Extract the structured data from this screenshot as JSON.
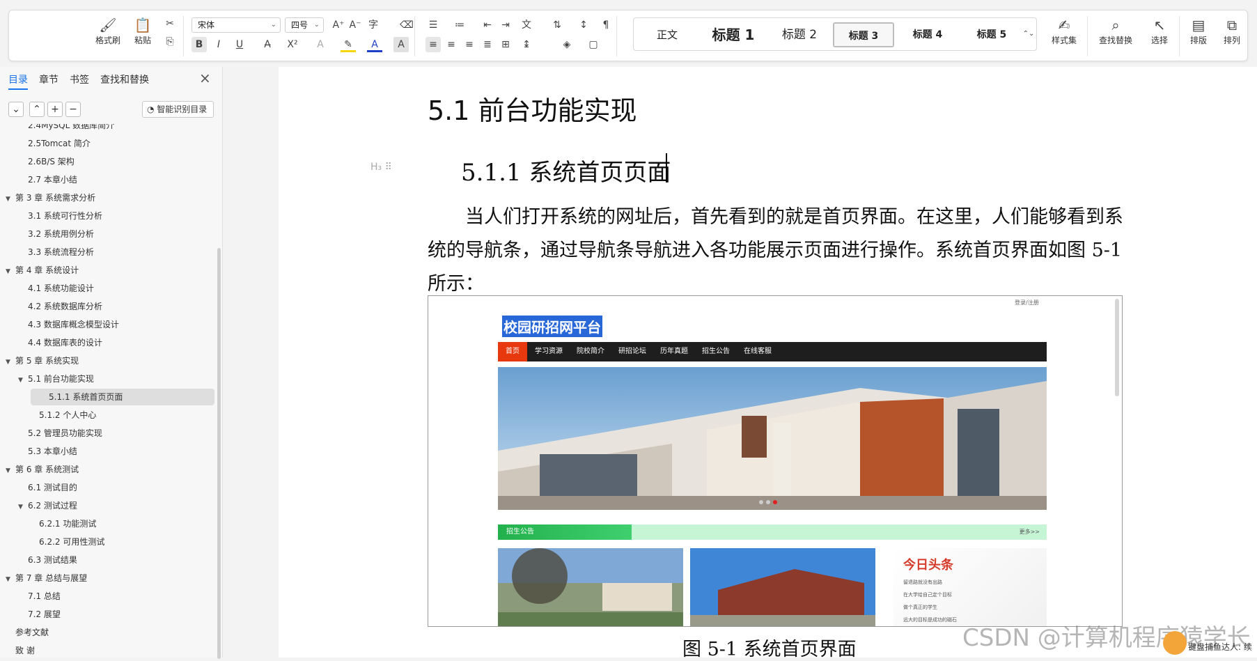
{
  "ribbon": {
    "format_painter": "格式刷",
    "paste": "粘贴",
    "font_name": "宋体",
    "font_size": "四号",
    "styles": [
      "正文",
      "标题 1",
      "标题 2",
      "标题 3",
      "标题 4",
      "标题 5"
    ],
    "style_set": "样式集",
    "find_replace": "查找替换",
    "select": "选择",
    "layout": "排版",
    "arrange": "排列"
  },
  "sidebar": {
    "tabs": [
      "目录",
      "章节",
      "书签",
      "查找和替换"
    ],
    "smart_toc": "智能识别目录",
    "toc": [
      {
        "label": "2.4MySQL 数据库简介",
        "level": 2
      },
      {
        "label": "2.5Tomcat 简介",
        "level": 2
      },
      {
        "label": "2.6B/S 架构",
        "level": 2
      },
      {
        "label": "2.7 本章小结",
        "level": 2
      },
      {
        "label": "第 3 章  系统需求分析",
        "level": 1
      },
      {
        "label": "3.1 系统可行性分析",
        "level": 2
      },
      {
        "label": "3.2 系统用例分析",
        "level": 2
      },
      {
        "label": "3.3 系统流程分析",
        "level": 2
      },
      {
        "label": "第 4 章  系统设计",
        "level": 1
      },
      {
        "label": "4.1 系统功能设计",
        "level": 2
      },
      {
        "label": "4.2 系统数据库分析",
        "level": 2
      },
      {
        "label": "4.3 数据库概念模型设计",
        "level": 2
      },
      {
        "label": "4.4 数据库表的设计",
        "level": 2
      },
      {
        "label": "第 5 章  系统实现",
        "level": 1
      },
      {
        "label": "5.1 前台功能实现",
        "level": 2
      },
      {
        "label": "5.1.1 系统首页页面",
        "level": 3
      },
      {
        "label": "5.1.2 个人中心",
        "level": 3
      },
      {
        "label": "5.2 管理员功能实现",
        "level": 2
      },
      {
        "label": "5.3 本章小结",
        "level": 2
      },
      {
        "label": "第 6 章  系统测试",
        "level": 1
      },
      {
        "label": "6.1 测试目的",
        "level": 2
      },
      {
        "label": "6.2 测试过程",
        "level": 2
      },
      {
        "label": "6.2.1 功能测试",
        "level": 3
      },
      {
        "label": "6.2.2 可用性测试",
        "level": 3
      },
      {
        "label": "6.3 测试结果",
        "level": 2
      },
      {
        "label": "第 7 章  总结与展望",
        "level": 1
      },
      {
        "label": "7.1 总结",
        "level": 2
      },
      {
        "label": "7.2 展望",
        "level": 2
      },
      {
        "label": "参考文献",
        "level": 1
      },
      {
        "label": "致  谢",
        "level": 1
      }
    ]
  },
  "document": {
    "heading2": "5.1 前台功能实现",
    "heading3": "5.1.1 系统首页页面",
    "paragraph": "当人们打开系统的网址后，首先看到的就是首页界面。在这里，人们能够看到系统的导航条，通过导航条导航进入各功能展示页面进行操作。系统首页界面如图 5-1 所示：",
    "caption": "图 5-1  系统首页界面"
  },
  "website": {
    "title": "校园研招网平台",
    "login": "登录/注册",
    "nav": [
      "首页",
      "学习资源",
      "院校简介",
      "研招论坛",
      "历年真题",
      "招生公告",
      "在线客服"
    ],
    "notice": "招生公告",
    "more": "更多>>",
    "news_title": "今日头条",
    "news": [
      "留退路就没有出路",
      "在大学给自己定个目标",
      "做个真正的学生",
      "远大的目标是成功的磁石"
    ]
  },
  "overlay": {
    "watermark": "CSDN @计算机程序猿学长",
    "tip": "键盘捕鱼达人: 续"
  },
  "colors": {
    "accent": "#1a73e8",
    "nav_active": "#e8380d",
    "notice_green": "#22b14c"
  }
}
